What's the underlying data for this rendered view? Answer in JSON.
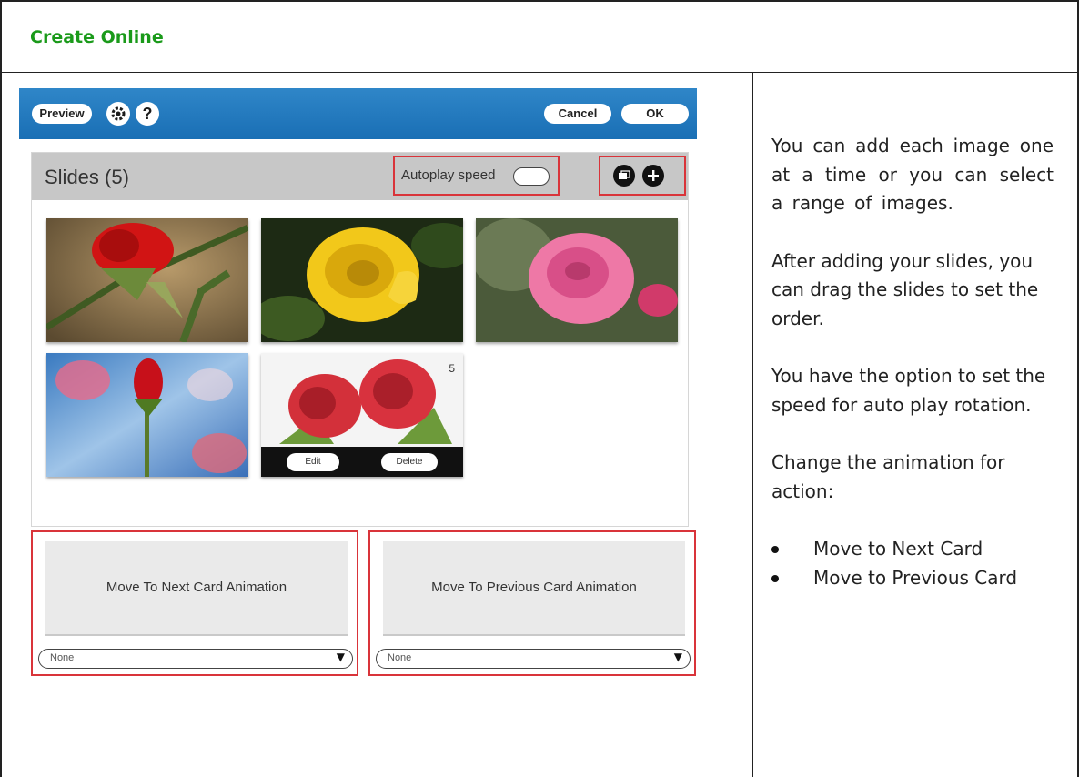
{
  "header": {
    "title": "Create Online"
  },
  "toolbar": {
    "preview_label": "Preview",
    "help_glyph": "?",
    "cancel_label": "Cancel",
    "ok_label": "OK",
    "settings_icon": "gear-icon"
  },
  "slides_panel": {
    "title": "Slides (5)",
    "autoplay_label": "Autoplay speed",
    "icons": [
      "layers-icon",
      "plus-icon"
    ],
    "thumbnails": [
      {
        "name": "red-rose-thorn"
      },
      {
        "name": "yellow-rose"
      },
      {
        "name": "pink-rose"
      },
      {
        "name": "red-rose-bud-blue"
      },
      {
        "name": "red-roses-pair",
        "badge": "5",
        "edit_label": "Edit",
        "delete_label": "Delete"
      }
    ]
  },
  "animations": {
    "next": {
      "label": "Move To Next Card Animation",
      "value": "None"
    },
    "previous": {
      "label": "Move To Previous Card Animation",
      "value": "None"
    }
  },
  "instructions": {
    "p1": "You can add each image one at a time or you can select a range of images.",
    "p2": "After adding your slides, you can drag the slides to set the order.",
    "p3": "You have the option to set the speed for auto play rotation.",
    "p4": "Change the animation for action:",
    "bullets": [
      "Move to Next Card",
      "Move to Previous Card"
    ]
  },
  "colors": {
    "title_green": "#1a9a1a",
    "accent_blue": "#2f86c8",
    "highlight_red": "#d9343a"
  }
}
